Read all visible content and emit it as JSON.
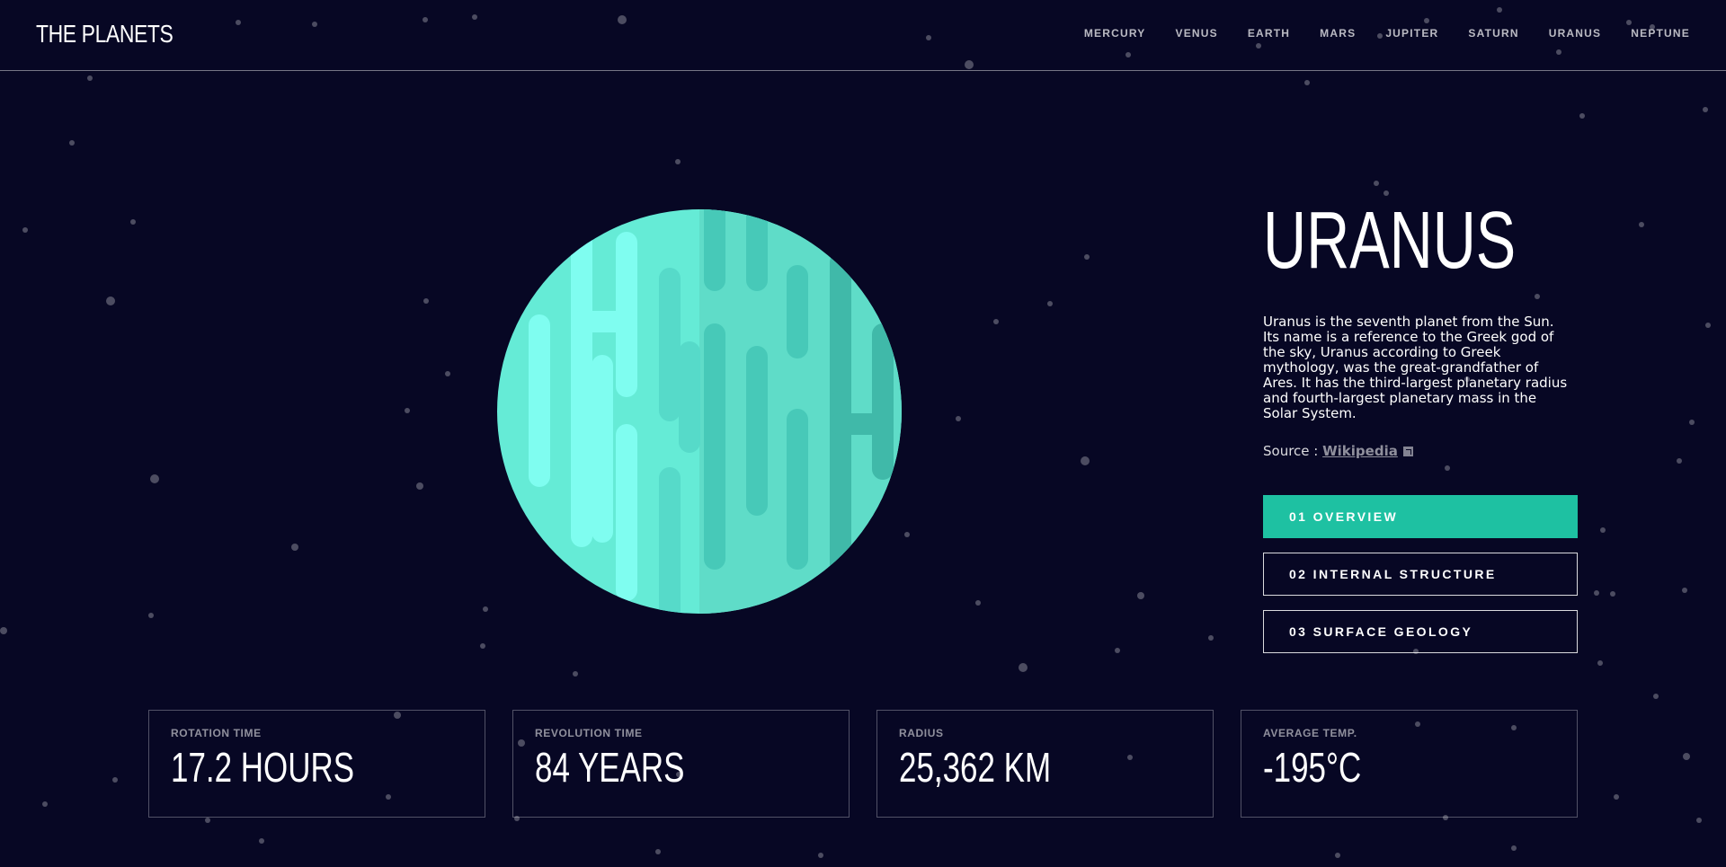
{
  "app": {
    "logo": "THE PLANETS"
  },
  "nav": {
    "items": [
      "MERCURY",
      "VENUS",
      "EARTH",
      "MARS",
      "JUPITER",
      "SATURN",
      "URANUS",
      "NEPTUNE"
    ]
  },
  "planet": {
    "name": "URANUS",
    "description": "Uranus is the seventh planet from the Sun. Its name is a reference to the Greek god of the sky, Uranus according to Greek mythology, was the great-grandfather of Ares. It has the third-largest planetary radius and fourth-largest planetary mass in the Solar System.",
    "source_label": "Source :",
    "source_link": "Wikipedia"
  },
  "tabs": [
    {
      "number": "01",
      "label": "OVERVIEW",
      "active": true
    },
    {
      "number": "02",
      "label": "INTERNAL STRUCTURE",
      "active": false
    },
    {
      "number": "03",
      "label": "SURFACE GEOLOGY",
      "active": false
    }
  ],
  "stats": [
    {
      "label": "ROTATION TIME",
      "value": "17.2 HOURS"
    },
    {
      "label": "REVOLUTION TIME",
      "value": "84 YEARS"
    },
    {
      "label": "RADIUS",
      "value": "25,362 KM"
    },
    {
      "label": "AVERAGE TEMP.",
      "value": "-195°C"
    }
  ],
  "colors": {
    "background": "#070724",
    "accent": "#1ec1a2",
    "planet_light": "#6be9d8",
    "planet_dark": "#4fcfbe"
  }
}
